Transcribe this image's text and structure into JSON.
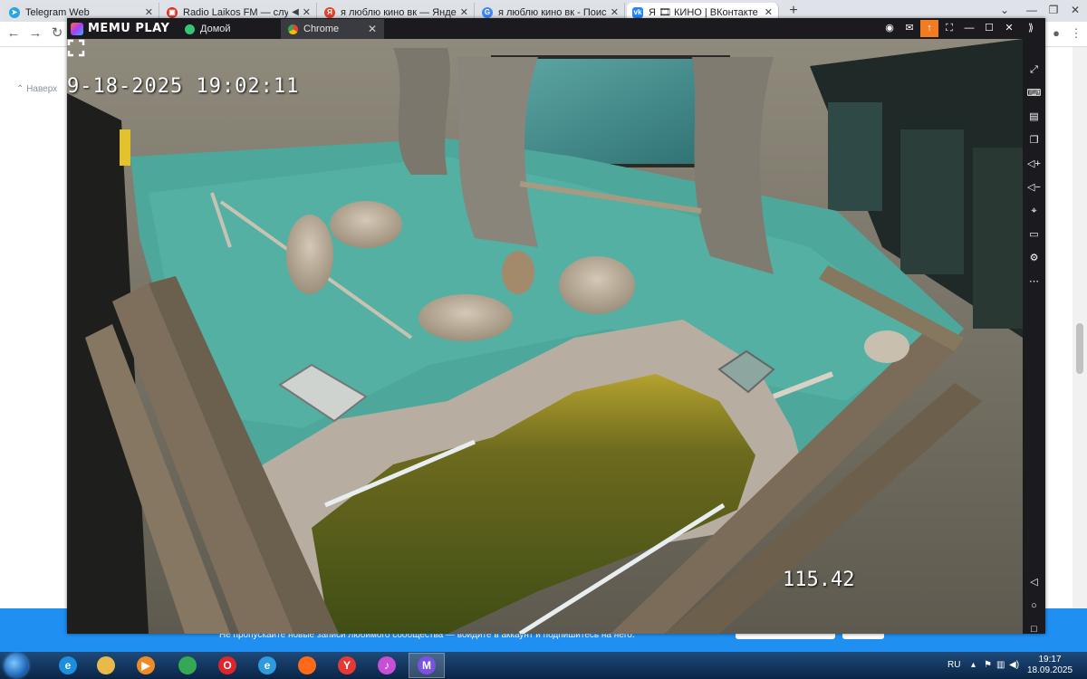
{
  "browser": {
    "tabs": [
      {
        "label": "Telegram Web",
        "icon": "telegram-icon",
        "color": "#2aa3e2"
      },
      {
        "label": "Radio Laikos FM — слушать",
        "icon": "radio-icon",
        "color": "#d93025",
        "muted_icon": "speaker-icon"
      },
      {
        "label": "я люблю кино вк — Яндекс: на",
        "icon": "yandex-icon",
        "color": "#e0442f"
      },
      {
        "label": "я люблю кино вк - Поиск в Goo",
        "icon": "google-icon",
        "color": "#4285f4"
      },
      {
        "label": "Я 🎞 КИНО | ВКонтакте",
        "icon": "vk-icon",
        "color": "#2787f5"
      }
    ],
    "back_link": "Наверх"
  },
  "memu": {
    "logo": "MEMU PLAY",
    "tabs": [
      {
        "label": "Домой",
        "icon": "home-icon",
        "color": "#34c47a"
      },
      {
        "label": "Chrome",
        "icon": "chrome-icon",
        "color": "#4285f4"
      }
    ]
  },
  "camera": {
    "timestamp": "9-18-2025 19:02:11",
    "counter": "115.42"
  },
  "page": {
    "band_text": "Не пропускайте новые записи любимого сообщества — войдите в аккаунт и подпишитесь на него."
  },
  "taskbar": {
    "language": "RU",
    "time": "19:17",
    "date": "18.09.2025",
    "apps": [
      {
        "name": "internet-explorer-icon",
        "color": "#1a8fe0",
        "glyph": "e"
      },
      {
        "name": "file-explorer-icon",
        "color": "#e9b949",
        "glyph": ""
      },
      {
        "name": "media-player-icon",
        "color": "#f08a24",
        "glyph": "▶"
      },
      {
        "name": "chrome-icon",
        "color": "#34a853",
        "glyph": ""
      },
      {
        "name": "opera-icon",
        "color": "#e0242c",
        "glyph": "O"
      },
      {
        "name": "edge-icon",
        "color": "#2f9ae0",
        "glyph": "e"
      },
      {
        "name": "firefox-icon",
        "color": "#ff6a1a",
        "glyph": ""
      },
      {
        "name": "yandex-browser-icon",
        "color": "#e53935",
        "glyph": "Y"
      },
      {
        "name": "itunes-icon",
        "color": "#c64fd6",
        "glyph": "♪"
      },
      {
        "name": "memu-icon",
        "color": "#7a52e0",
        "glyph": "M"
      }
    ]
  }
}
